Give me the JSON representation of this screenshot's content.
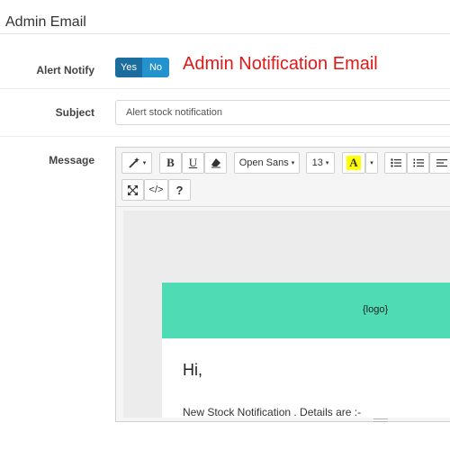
{
  "section": {
    "title": "Admin Email"
  },
  "alert_notify": {
    "label": "Alert Notify",
    "yes_label": "Yes",
    "no_label": "No",
    "selected": "Yes",
    "annotation": "Admin Notification Email",
    "annotation_color": "#e01818"
  },
  "subject": {
    "label": "Subject",
    "value": "Alert stock notification"
  },
  "message": {
    "label": "Message",
    "toolbar": {
      "bold_label": "B",
      "underline_label": "U",
      "font_family": "Open Sans",
      "font_size": "13",
      "color_label": "A",
      "code_view_label": "</>",
      "help_label": "?"
    },
    "email": {
      "logo_placeholder": "{logo}",
      "greeting": "Hi,",
      "body_line": "New Stock Notification . Details are :-",
      "header_color": "#4fdbb4"
    }
  },
  "colors": {
    "toggle_yes": "#1b6d9e",
    "toggle_no": "#2592d0"
  }
}
